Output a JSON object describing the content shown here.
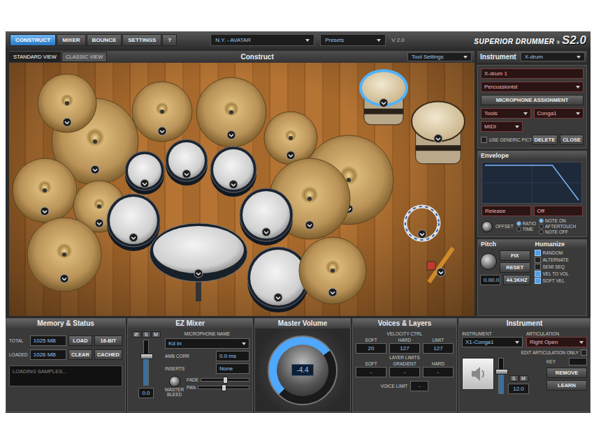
{
  "top_tabs": [
    {
      "label": "CONSTRUCT",
      "selected": true
    },
    {
      "label": "MIXER",
      "selected": false
    },
    {
      "label": "BOUNCE",
      "selected": false
    },
    {
      "label": "SETTINGS",
      "selected": false
    },
    {
      "label": "?",
      "selected": false
    }
  ],
  "kit_preset": "N.Y. - AVATAR",
  "presets": "Presets",
  "version": "V 2.0",
  "logo": {
    "name": "SUPERIOR DRUMMER",
    "mark": "®",
    "model": "S2.0"
  },
  "view_tabs": [
    {
      "label": "STANDARD VIEW",
      "selected": true
    },
    {
      "label": "CLASSIC VIEW",
      "selected": false
    }
  ],
  "canvas": {
    "title": "Construct",
    "tool_settings": "Tool Settings",
    "pieces": [
      {
        "kind": "cymbal",
        "selected": false
      },
      {
        "kind": "cymbal",
        "selected": false
      },
      {
        "kind": "cymbal",
        "selected": false
      },
      {
        "kind": "cymbal",
        "selected": false
      },
      {
        "kind": "cymbal",
        "selected": false
      },
      {
        "kind": "cymbal",
        "selected": false
      },
      {
        "kind": "cymbal",
        "selected": false
      },
      {
        "kind": "cymbal",
        "selected": false
      },
      {
        "kind": "tom",
        "selected": false
      },
      {
        "kind": "tom",
        "selected": false
      },
      {
        "kind": "tom",
        "selected": false
      },
      {
        "kind": "cymbal",
        "selected": false
      },
      {
        "kind": "tom",
        "selected": false
      },
      {
        "kind": "kick",
        "selected": false
      },
      {
        "kind": "tom",
        "selected": false
      },
      {
        "kind": "tom",
        "selected": false
      },
      {
        "kind": "cymbal",
        "selected": false
      },
      {
        "kind": "cymbal",
        "selected": false
      },
      {
        "kind": "conga",
        "selected": true
      },
      {
        "kind": "conga",
        "selected": false
      },
      {
        "kind": "tambourine",
        "selected": false
      },
      {
        "kind": "stick",
        "selected": false
      }
    ]
  },
  "instrument_panel": {
    "title": "Instrument",
    "type": "X-drum",
    "name": "X-drum 1",
    "category": "Percussionist",
    "mic_button": "MICROPHONE ASSIGNMENT",
    "tools": "Tools",
    "instrument": "Conga1",
    "midi": "MIDI",
    "generic_picture": {
      "label": "USE GENERIC PICTURE",
      "checked": false
    },
    "buttons": [
      "DELETE",
      "CLOSE"
    ]
  },
  "envelope": {
    "title": "Envelope",
    "points": [
      [
        0,
        1
      ],
      [
        0.72,
        1
      ],
      [
        1,
        0
      ]
    ],
    "parameter": "Release",
    "value": "Off",
    "knob_label": "OFFSET",
    "modes": [
      {
        "label": "RATIO",
        "selected": true
      },
      {
        "label": "TIME",
        "selected": false
      }
    ],
    "triggers": [
      {
        "label": "NOTE ON",
        "selected": true
      },
      {
        "label": "AFTERTOUCH",
        "selected": false
      },
      {
        "label": "NOTE OFF",
        "selected": false
      }
    ]
  },
  "pitch": {
    "title": "Pitch",
    "buttons": [
      "FIX",
      "RESET"
    ],
    "value": "0.00.0",
    "rate": "44.1KHZ"
  },
  "humanize": {
    "title": "Humanize",
    "options": [
      {
        "label": "RANDOM",
        "checked": true
      },
      {
        "label": "ALTERNATE",
        "checked": false
      },
      {
        "label": "SEMI SEQ",
        "checked": false
      },
      {
        "label": "VEL TO VOL",
        "checked": true
      },
      {
        "label": "SOFT VEL",
        "checked": true
      }
    ]
  },
  "memory": {
    "title": "Memory & Status",
    "rows": [
      {
        "label": "TOTAL",
        "value": "1025 MB"
      },
      {
        "label": "LOADED",
        "value": "1026 MB"
      }
    ],
    "buttons": [
      {
        "label": "LOAD",
        "on": false
      },
      {
        "label": "16-BIT",
        "on": false
      },
      {
        "label": "CLEAR",
        "on": false
      },
      {
        "label": "CACHED",
        "on": false
      }
    ],
    "status": "LOADING SAMPLES..."
  },
  "ez_mixer": {
    "title": "EZ Mixer",
    "channel_buttons": [
      "Ø",
      "S",
      "M"
    ],
    "fader_level": 0.62,
    "fader_value": "0.0",
    "mic_label": "MICROPHONE NAME",
    "mic": "Kd In",
    "fields": [
      {
        "label": "AMB CORR",
        "value": "0.0 ms"
      },
      {
        "label": "INSERTS",
        "value": "None"
      }
    ],
    "bleed_label": [
      "MASTER",
      "BLEED"
    ],
    "sliders": [
      {
        "label": "FADE",
        "level": 0.5
      },
      {
        "label": "PAN",
        "level": 0.5
      }
    ]
  },
  "master_volume": {
    "title": "Master Volume",
    "value": "-4.4",
    "level": 0.7
  },
  "voices": {
    "title": "Voices & Layers",
    "velocity_label": "VELOCITY CTRL",
    "velocity": [
      {
        "label": "SOFT",
        "value": "20"
      },
      {
        "label": "HARD",
        "value": "127"
      },
      {
        "label": "LIMIT",
        "value": "127"
      }
    ],
    "layer_label": "LAYER LIMITS",
    "layers": [
      {
        "label": "SOFT",
        "value": "-"
      },
      {
        "label": "GRADIENT",
        "value": "-"
      },
      {
        "label": "HARD",
        "value": "-"
      }
    ],
    "voice_limit_label": "VOICE LIMIT",
    "voice_limit": "-"
  },
  "instrument_bottom": {
    "title": "Instrument",
    "instrument_label": "INSTRUMENT",
    "instrument": "X1-Conga1",
    "articulation_label": "ARTICULATION",
    "articulation": "Right Open",
    "edit_only": {
      "label": "EDIT ARTICULATION ONLY",
      "checked": false
    },
    "key_label": "KEY",
    "buttons": [
      "REMOVE",
      "LEARN"
    ],
    "channel_buttons": [
      "S",
      "M"
    ],
    "fader_level": 0.6,
    "value": "12.0"
  }
}
